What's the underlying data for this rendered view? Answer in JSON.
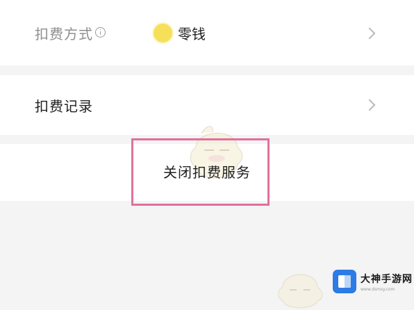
{
  "deduction_method": {
    "label": "扣费方式",
    "value": "零钱"
  },
  "deduction_records": {
    "label": "扣费记录"
  },
  "close_service": {
    "label": "关闭扣费服务"
  },
  "watermark": {
    "brand_name": "大神手游网",
    "brand_url": "www.dsmsy.com"
  },
  "colors": {
    "background": "#f4f4f4",
    "row_background": "#ffffff",
    "highlight_border": "#e0709a",
    "coin": "#f6e05a",
    "brand_blue": "#2d7be5"
  },
  "icons": [
    "info-icon",
    "coin-icon",
    "chevron-right-icon",
    "brand-logo-icon"
  ]
}
